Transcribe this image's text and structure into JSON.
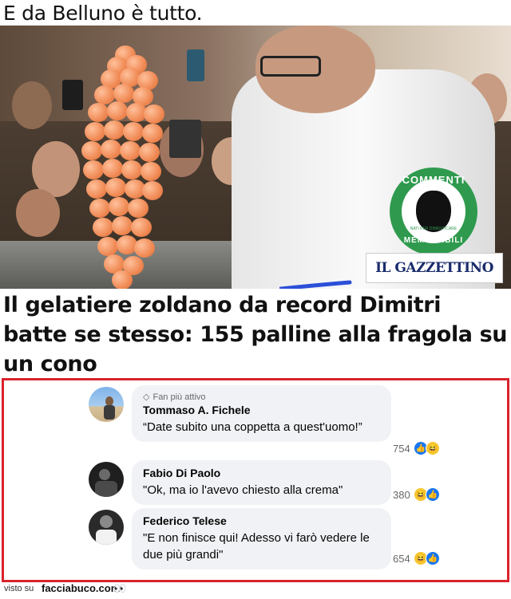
{
  "top_caption": "E da Belluno è tutto.",
  "photo": {
    "badge": {
      "top": "COMMENTI",
      "small": "NATI PER DIMENTICARE",
      "bottom": "MEMORABILI"
    },
    "watermark": "IL GAZZETTINO"
  },
  "headline": "Il gelatiere zoldano da record Dimitri batte se stesso: 155 palline alla fragola su un cono",
  "comments": [
    {
      "badge": "Fan più attivo",
      "name": "Tommaso A. Fichele",
      "text": "“Date subito una coppetta a quest'uomo!”",
      "count": "754"
    },
    {
      "name": "Fabio Di Paolo",
      "text": "\"Ok, ma io l'avevo chiesto alla crema\"",
      "count": "380"
    },
    {
      "name": "Federico Telese",
      "text": "\"E non finisce qui! Adesso vi farò vedere le due più grandi\"",
      "count": "654"
    }
  ],
  "footer": {
    "prefix": "visto su",
    "site": "facciabuco.com",
    "eyes": "👀"
  },
  "colors": {
    "border": "#d9232d",
    "badge_green": "#2f9a4e",
    "like_blue": "#1877f2",
    "haha_yellow": "#f7c730"
  }
}
